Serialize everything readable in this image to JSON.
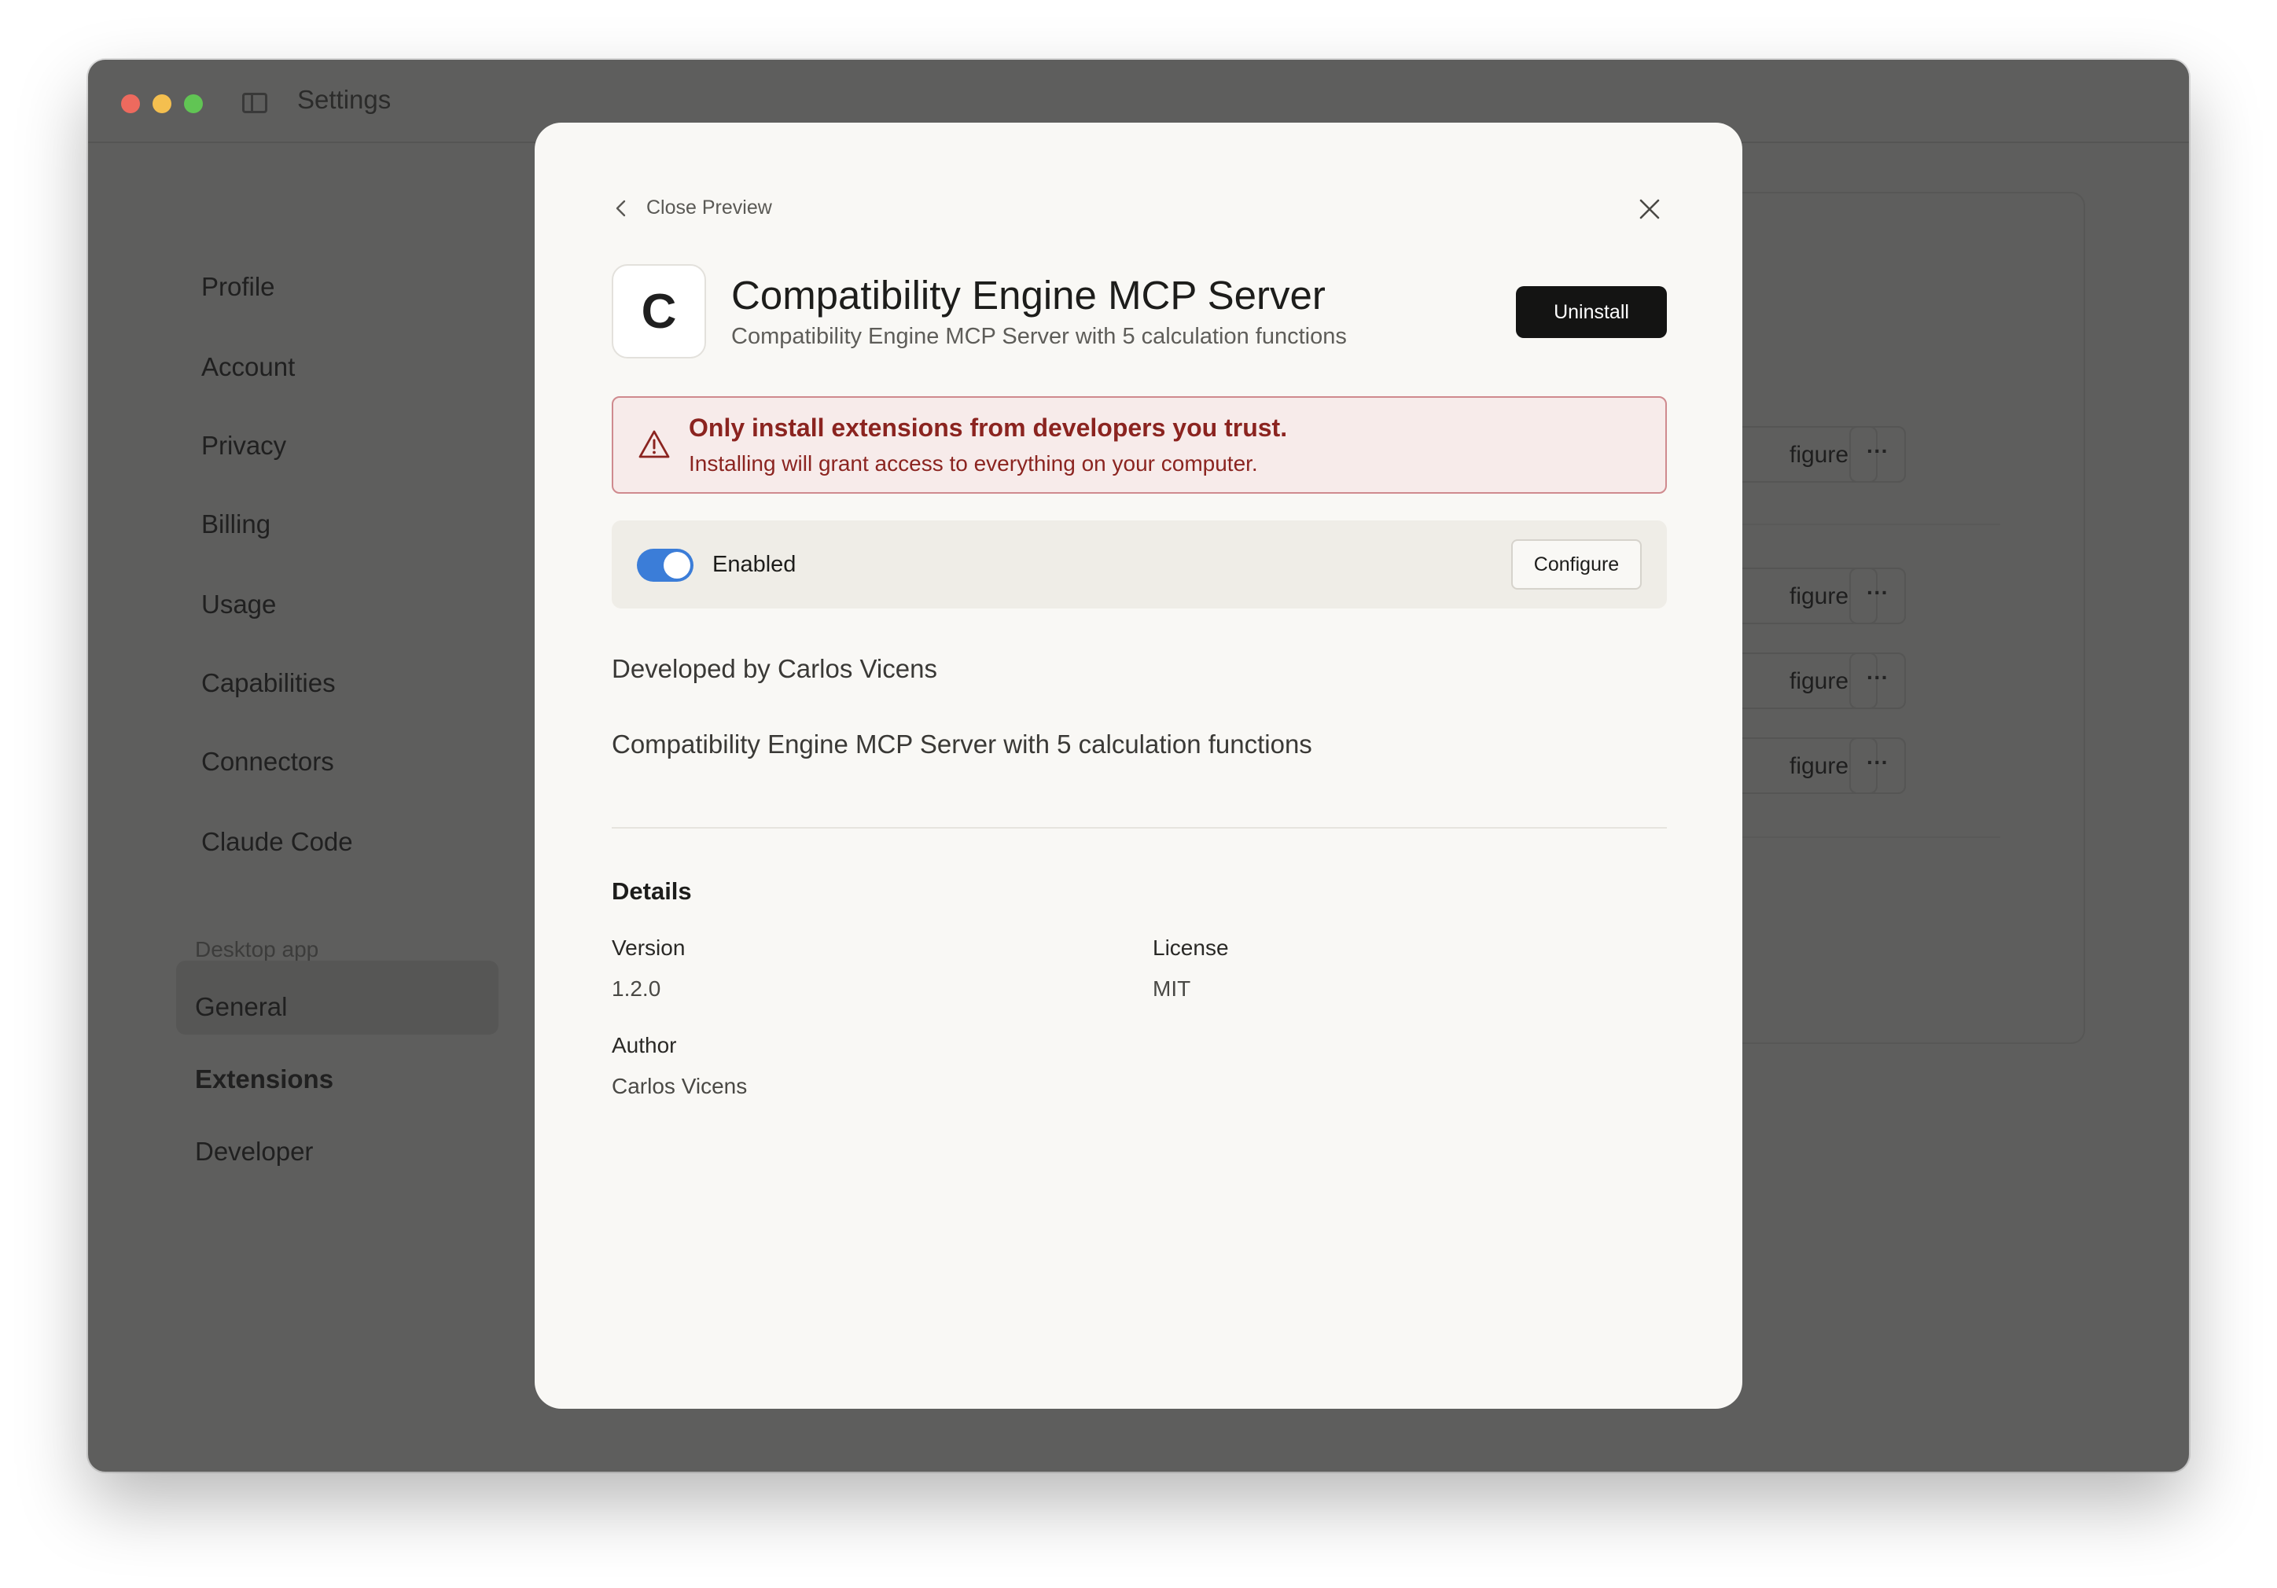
{
  "window": {
    "title": "Settings"
  },
  "nav": {
    "items": [
      "Profile",
      "Account",
      "Privacy",
      "Billing",
      "Usage",
      "Capabilities",
      "Connectors",
      "Claude Code"
    ],
    "section_label": "Desktop app",
    "section_items": [
      "General",
      "Extensions",
      "Developer"
    ],
    "active": "Extensions"
  },
  "background": {
    "configure_label_partial": "figure",
    "more_label": "···"
  },
  "modal": {
    "back_label": "Close Preview",
    "icon_letter": "C",
    "title": "Compatibility Engine MCP Server",
    "subtitle": "Compatibility Engine MCP Server with 5 calculation functions",
    "uninstall_label": "Uninstall",
    "warning": {
      "title": "Only install extensions from developers you trust.",
      "text": "Installing will grant access to everything on your computer."
    },
    "enabled": {
      "label": "Enabled",
      "on": true,
      "configure_label": "Configure"
    },
    "developed_by": "Developed by Carlos Vicens",
    "description": "Compatibility Engine MCP Server with 5 calculation functions",
    "details": {
      "heading": "Details",
      "version_label": "Version",
      "version_value": "1.2.0",
      "license_label": "License",
      "license_value": "MIT",
      "author_label": "Author",
      "author_value": "Carlos Vicens"
    }
  },
  "colors": {
    "toggle_on": "#3b7dd8",
    "warning_text": "#8b2420",
    "warning_bg": "#f7ebea",
    "primary_button": "#141413"
  }
}
